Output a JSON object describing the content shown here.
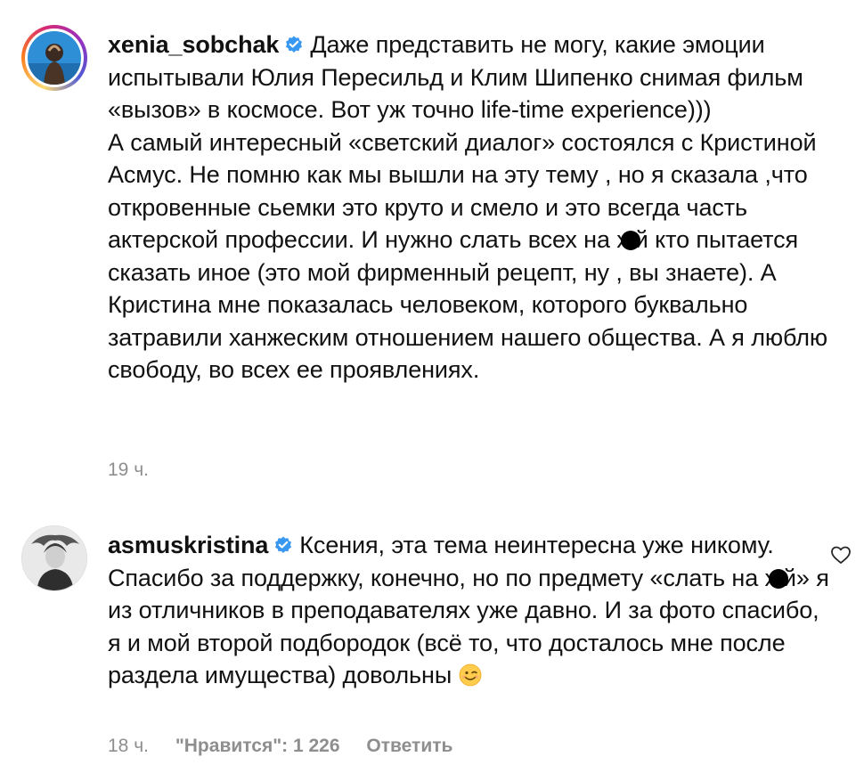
{
  "comments": [
    {
      "username": "xenia_sobchak",
      "text_part1": "Даже представить не могу, какие эмоции испытывали Юлия Пересильд и Клим Шипенко снимая фильм «вызов» в космосе. Вот уж точно life-time experience)))",
      "text_part2a": "А самый интересный «светский диалог» состоялся с Кристиной Асмус. Не помню как мы вышли на эту тему , но я сказала ,что откровенные сьемки это круто и смело и это всегда часть актерской профессии. И нужно слать всех на х",
      "text_part2b": "й кто пытается сказать иное (это мой фирменный рецепт, ну , вы знаете). А Кристина мне показалась человеком, которого буквально затравили ханжеским отношением нашего общества. А я люблю свободу, во всех ее проявлениях.",
      "time": "19 ч."
    },
    {
      "username": "asmuskristina",
      "text_part1": "Ксения, эта тема неинтересна уже никому. Спасибо за поддержку, конечно, но по предмету «слать на х",
      "text_part2": "й» я из отличников в преподавателях уже давно. И за фото спасибо, я и мой второй подбородок (всё то, что досталось мне после раздела имущества) довольны",
      "time": "18 ч.",
      "likes": "\"Нравится\": 1 226",
      "reply": "Ответить"
    }
  ],
  "icons": {
    "verified": "verified-badge-icon",
    "heart": "heart-outline-icon",
    "emoji": "winking-face-emoji",
    "verified_color": "#3897f0"
  }
}
